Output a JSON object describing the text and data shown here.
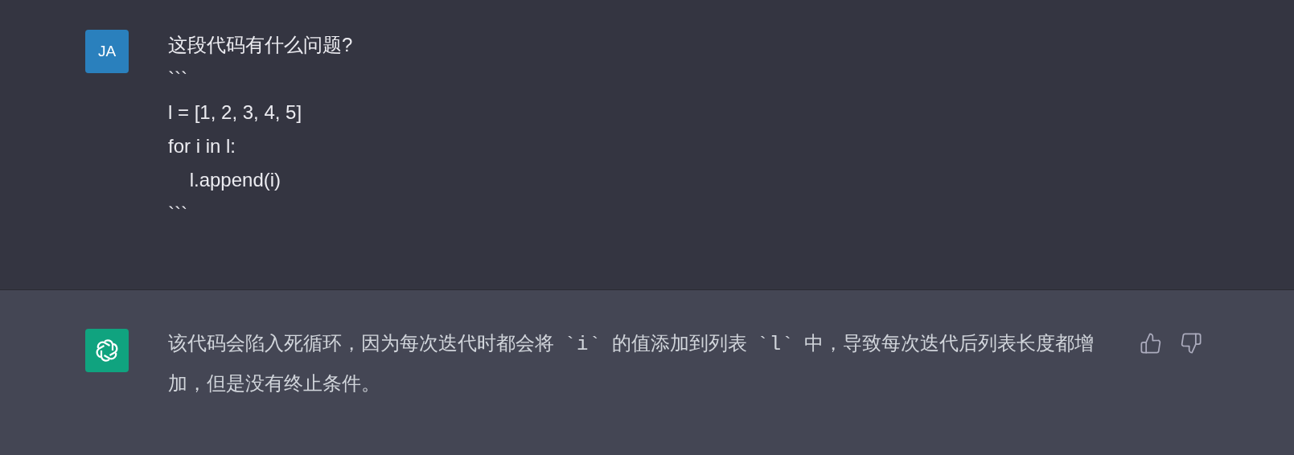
{
  "messages": [
    {
      "kind": "user",
      "avatar": "JA",
      "lines": [
        "这段代码有什么问题?",
        "```",
        "l = [1, 2, 3, 4, 5]",
        "for i in l:",
        "    l.append(i)",
        "```"
      ]
    },
    {
      "kind": "assistant",
      "text": "该代码会陷入死循环，因为每次迭代时都会将 `i` 的值添加到列表 `l` 中，导致每次迭代后列表长度都增加，但是没有终止条件。"
    }
  ]
}
